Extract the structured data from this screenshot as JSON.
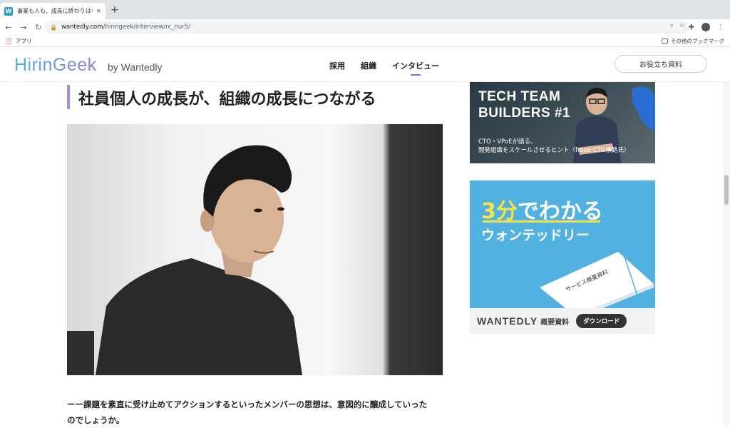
{
  "browser": {
    "tab_title": "事業も人も、成長に終わりはない。",
    "tab_close": "×",
    "new_tab": "+",
    "url_host": "wantedly.com",
    "url_path": "/hiringeek/interview/rc_nur5/",
    "bookmark_apps": "アプリ",
    "bookmark_other": "その他のブックマーク"
  },
  "site": {
    "logo": "HirinGeek",
    "logo_sub": "by Wantedly",
    "nav": [
      {
        "label": "採用"
      },
      {
        "label": "組織"
      },
      {
        "label": "インタビュー"
      }
    ],
    "cta": "お役立ち資料"
  },
  "article": {
    "heading": "社員個人の成長が、組織の成長につながる",
    "body_line1": "ーー課題を素直に受け止めてアクションするといったメンバーの思想は、意図的に醸成していった",
    "body_line2": "のでしょうか。"
  },
  "sidebar": {
    "banner1": {
      "title_line1": "TECH TEAM",
      "title_line2": "BUILDERS #1",
      "sub_line1": "CTO・VPoEが語る、",
      "sub_line2": "開発組織をスケールさせるヒント（freee CTO横路氏）"
    },
    "banner2": {
      "num": "3分",
      "rest": "でわかる",
      "line2": "ウォンテッドリー",
      "doc_label": "サービス概要資料",
      "brand": "WANTEDLY",
      "brand_jp": "概要資料",
      "button": "ダウンロード"
    }
  },
  "colors": {
    "accent_purple": "#a68be0",
    "banner_blue": "#51b1e0",
    "highlight_yellow": "#f6e24a"
  }
}
